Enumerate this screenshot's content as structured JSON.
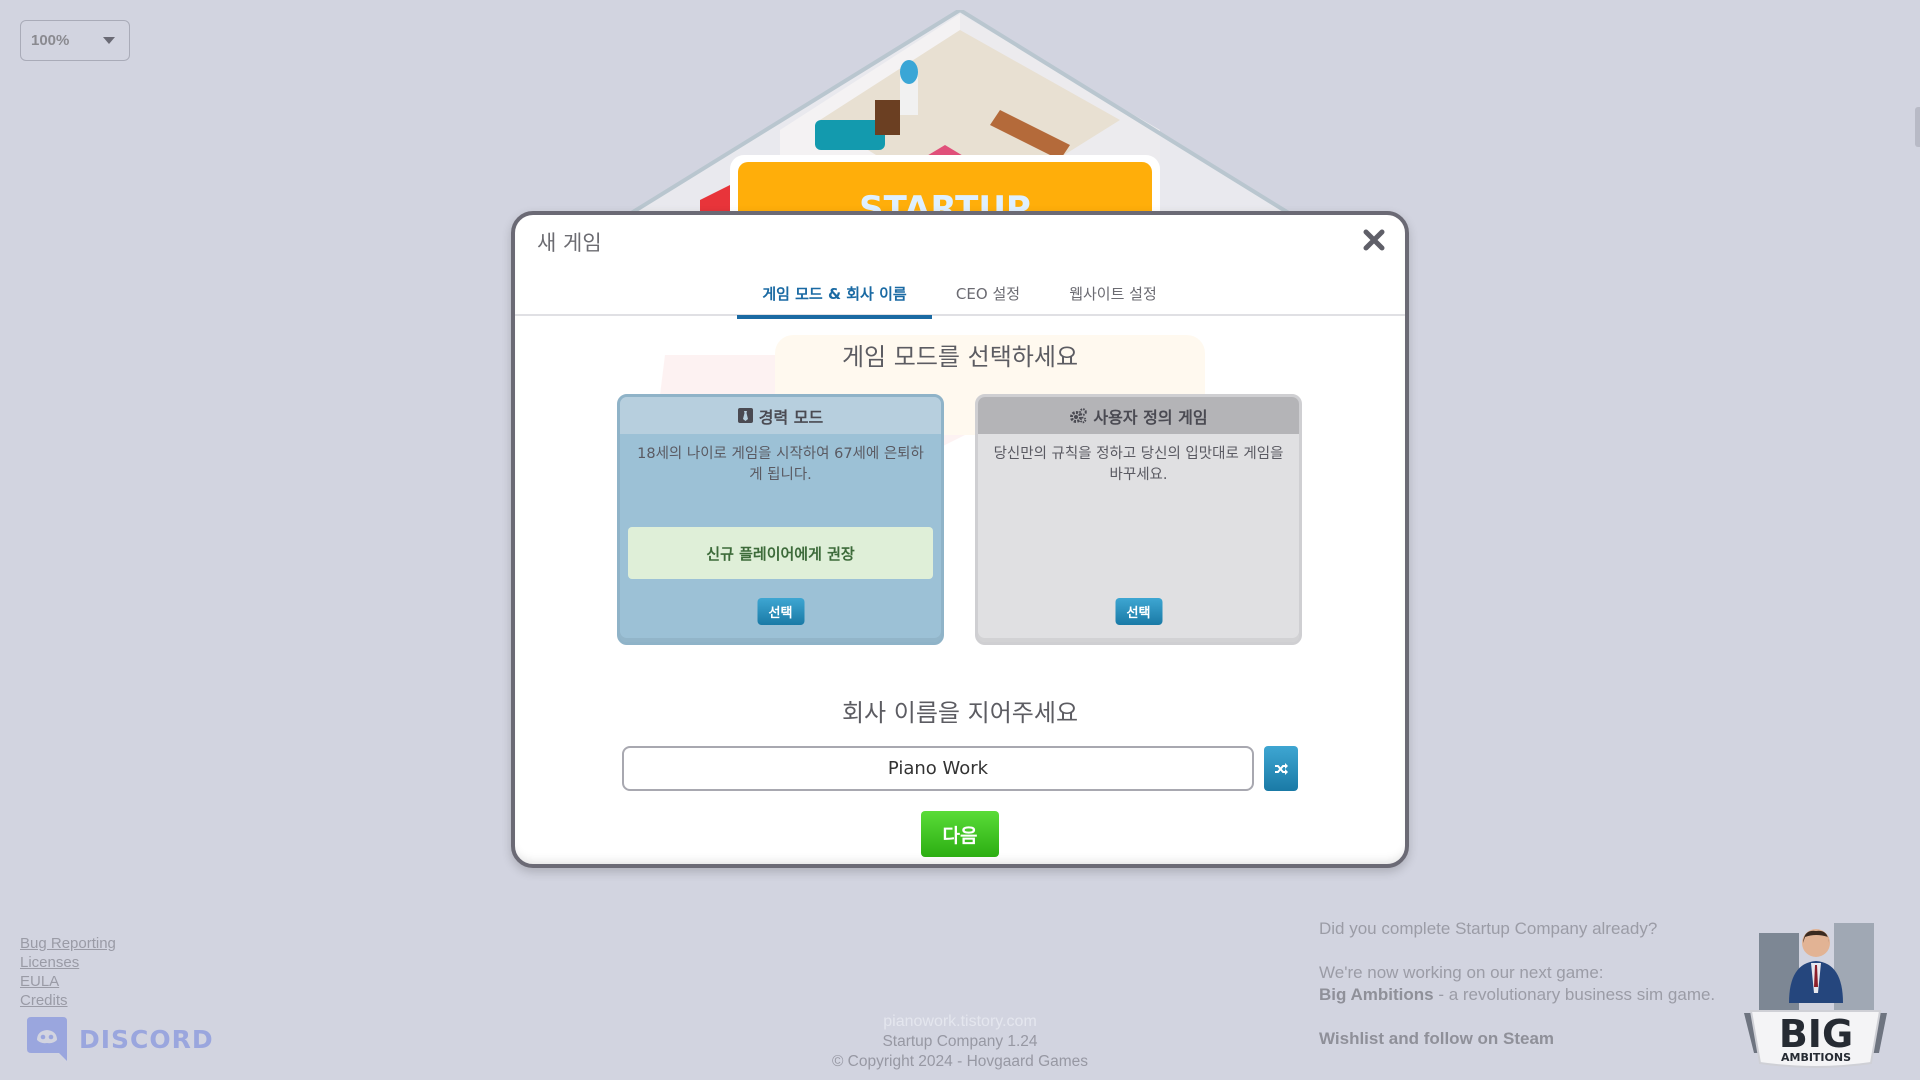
{
  "zoom_select": {
    "value": "100%"
  },
  "modal": {
    "title": "새 게임",
    "tabs": [
      {
        "label": "게임 모드 & 회사 이름",
        "active": true
      },
      {
        "label": "CEO 설정",
        "active": false
      },
      {
        "label": "웹사이트 설정",
        "active": false
      }
    ],
    "mode_heading": "게임 모드를 선택하세요",
    "modes": [
      {
        "title": "경력 모드",
        "icon": "tie-icon",
        "description": "18세의 나이로 게임을 시작하여 67세에 은퇴하게 됩니다.",
        "badge": "신규 플레이어에게 권장",
        "select_label": "선택"
      },
      {
        "title": "사용자 정의 게임",
        "icon": "gears-icon",
        "description": "당신만의 규칙을 정하고 당신의 입맛대로 게임을 바꾸세요.",
        "select_label": "선택"
      }
    ],
    "name_heading": "회사 이름을 지어주세요",
    "company_name": "Piano Work",
    "next_label": "다음"
  },
  "footer": {
    "links": [
      "Bug Reporting",
      "Licenses",
      "EULA",
      "Credits"
    ],
    "discord_label": "DISCORD",
    "watermark": "pianowork.tistory.com",
    "version": "Startup Company 1.24",
    "copyright": "© Copyright 2024 - Hovgaard Games"
  },
  "promo": {
    "question": "Did you complete Startup Company already?",
    "line1": "We're now working on our next game:",
    "game_name": "Big Ambitions",
    "game_desc": " - a revolutionary business sim game.",
    "cta": "Wishlist and follow on Steam",
    "logo_big": "BIG",
    "logo_sub": "AMBITIONS"
  },
  "colors": {
    "background": "#d2d4e0",
    "tab_active": "#1a6aa3",
    "career_card": "#9cc1d6",
    "custom_card": "#e0e0e2",
    "recommend_bg": "#dfefd8",
    "recommend_text": "#3d6b3a",
    "select_button": "#1a7aa6",
    "next_button": "#2cae12",
    "discord": "#9aa6de"
  }
}
